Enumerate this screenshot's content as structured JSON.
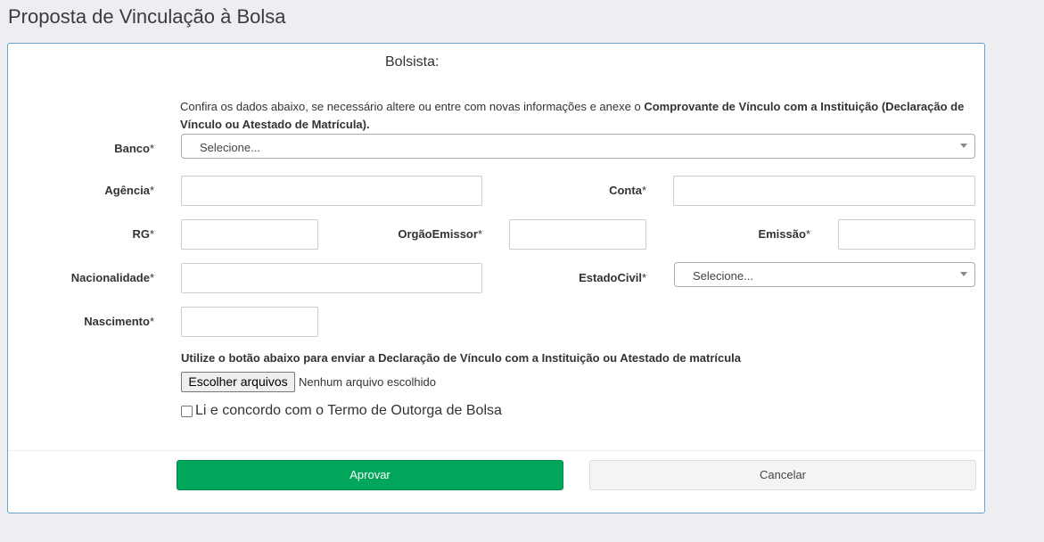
{
  "page": {
    "title": "Proposta de Vinculação à Bolsa"
  },
  "form": {
    "section_title": "Bolsista:",
    "intro_text": "Confira os dados abaixo, se necessário altere ou entre com novas informações e anexe o ",
    "intro_bold": "Comprovante de Vínculo com a Instituição (Declaração de Vínculo ou Atestado de Matrícula).",
    "required_mark": "*",
    "fields": {
      "banco": {
        "label": "Banco",
        "value": "Selecione..."
      },
      "agencia": {
        "label": "Agência",
        "value": ""
      },
      "conta": {
        "label": "Conta",
        "value": ""
      },
      "rg": {
        "label": "RG",
        "value": ""
      },
      "orgao_emissor": {
        "label": "OrgãoEmissor",
        "value": ""
      },
      "emissao": {
        "label": "Emissão",
        "value": ""
      },
      "nacionalidade": {
        "label": "Nacionalidade",
        "value": ""
      },
      "estado_civil": {
        "label": "EstadoCivil",
        "value": "Selecione..."
      },
      "nascimento": {
        "label": "Nascimento",
        "value": ""
      }
    },
    "upload": {
      "label": "Utilize o botão abaixo para enviar a Declaração de Vínculo com a Instituição ou Atestado de matrícula",
      "button_label": "Escolher arquivos",
      "status": "Nenhum arquivo escolhido"
    },
    "agreement": {
      "label": "Li e concordo com o Termo de Outorga de Bolsa",
      "checked": false
    },
    "actions": {
      "approve_label": "Aprovar",
      "cancel_label": "Cancelar"
    }
  },
  "colors": {
    "approve": "#02a65a",
    "panel_border": "#6e9fc4",
    "background": "#eceef2"
  }
}
